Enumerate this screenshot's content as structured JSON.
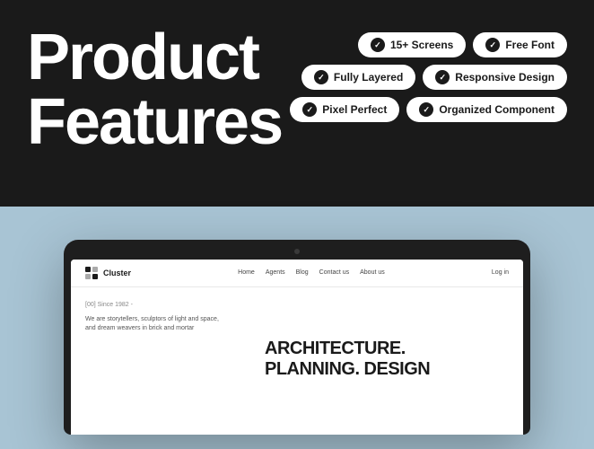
{
  "top": {
    "title_line1": "Product",
    "title_line2": "Features"
  },
  "badges": {
    "row1": [
      {
        "label": "15+ Screens"
      },
      {
        "label": "Free Font"
      }
    ],
    "row2": [
      {
        "label": "Fully Layered"
      },
      {
        "label": "Responsive Design"
      }
    ],
    "row3": [
      {
        "label": "Pixel Perfect"
      },
      {
        "label": "Organized Component"
      }
    ]
  },
  "device": {
    "nav": {
      "logo": "Cluster",
      "links": [
        "Home",
        "Agents",
        "Blog",
        "Contact us",
        "About us"
      ],
      "cta": "Log in"
    },
    "content": {
      "tag": "[00]   Since 1982 -",
      "description": "We are storytellers, sculptors of light and space,\nand dream weavers in brick and mortar",
      "hero_line1": "ARCHITECTURE.",
      "hero_line2": "PLANNING. DESIGN"
    }
  }
}
